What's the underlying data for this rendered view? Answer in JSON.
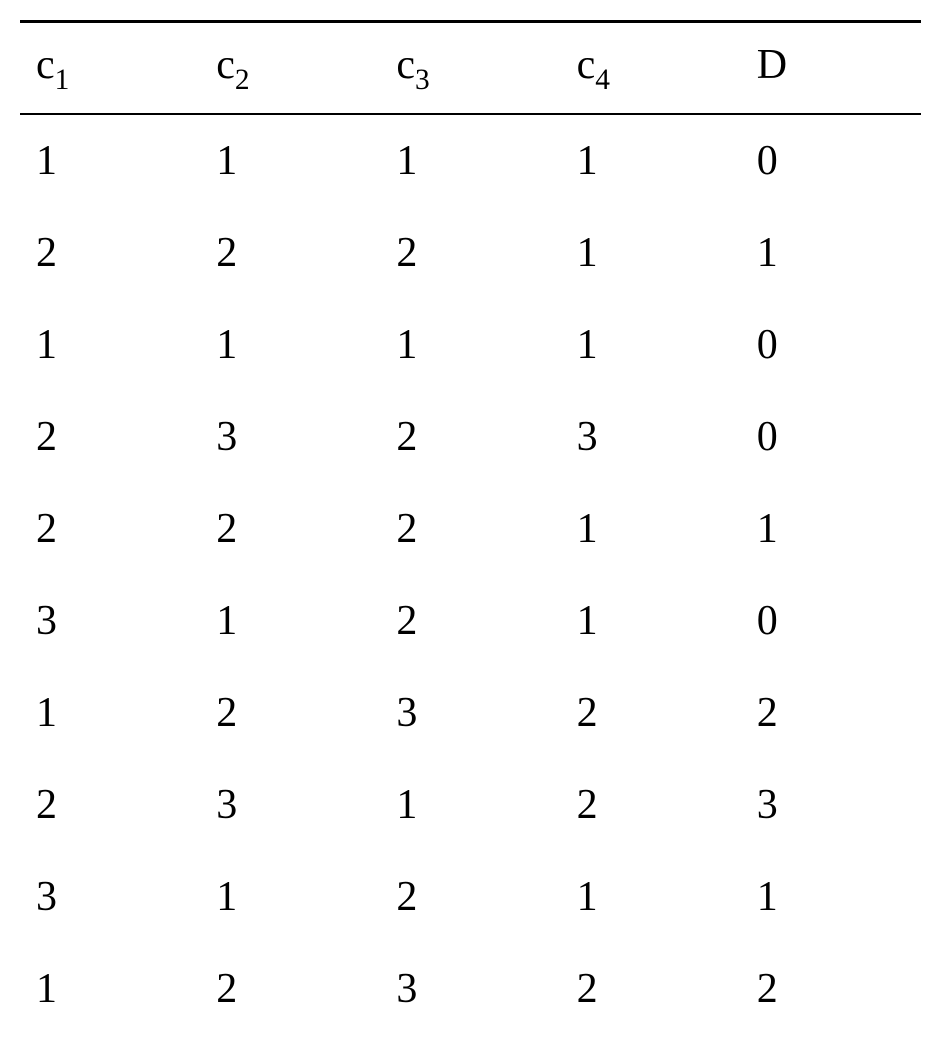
{
  "table": {
    "headers": [
      {
        "base": "c",
        "sub": "1"
      },
      {
        "base": "c",
        "sub": "2"
      },
      {
        "base": "c",
        "sub": "3"
      },
      {
        "base": "c",
        "sub": "4"
      },
      {
        "base": "D",
        "sub": ""
      }
    ],
    "rows": [
      [
        "1",
        "1",
        "1",
        "1",
        "0"
      ],
      [
        "2",
        "2",
        "2",
        "1",
        "1"
      ],
      [
        "1",
        "1",
        "1",
        "1",
        "0"
      ],
      [
        "2",
        "3",
        "2",
        "3",
        "0"
      ],
      [
        "2",
        "2",
        "2",
        "1",
        "1"
      ],
      [
        "3",
        "1",
        "2",
        "1",
        "0"
      ],
      [
        "1",
        "2",
        "3",
        "2",
        "2"
      ],
      [
        "2",
        "3",
        "1",
        "2",
        "3"
      ],
      [
        "3",
        "1",
        "2",
        "1",
        "1"
      ],
      [
        "1",
        "2",
        "3",
        "2",
        "2"
      ]
    ]
  }
}
